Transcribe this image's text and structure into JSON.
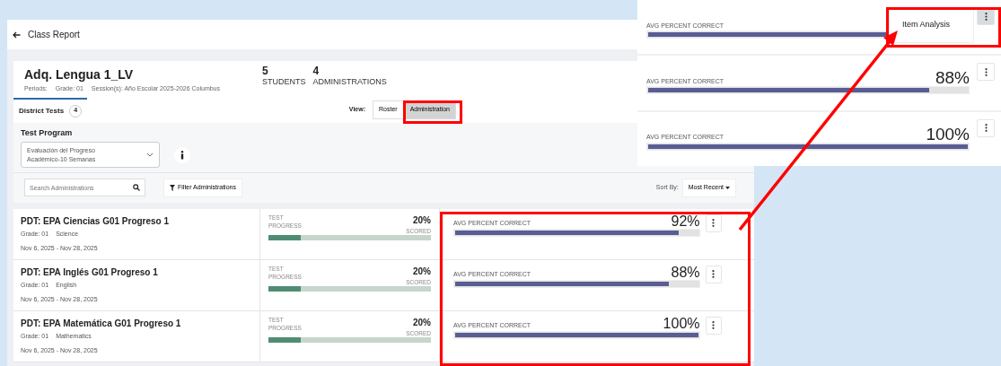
{
  "page": {
    "back_label": "Class Report"
  },
  "header": {
    "title": "Adq. Lengua 1_LV",
    "periods": "Periods:",
    "grade": "Grade: 01",
    "session": "Session(s): Año Escolar 2025-2026 Columbus",
    "stats": [
      {
        "value": "5",
        "label": "STUDENTS"
      },
      {
        "value": "4",
        "label": "ADMINISTRATIONS"
      }
    ]
  },
  "tabs": [
    {
      "label": "District Tests",
      "count": "4",
      "selected": true
    }
  ],
  "view": {
    "label": "View:",
    "options": [
      {
        "label": "Roster",
        "selected": false
      },
      {
        "label": "Administration",
        "selected": true
      }
    ]
  },
  "test_program": {
    "label": "Test Program",
    "value": "Evaluación del Progreso Académico-10 Semanas"
  },
  "search": {
    "placeholder": "Search Administrations"
  },
  "filter_button": "Filter Administrations",
  "sort": {
    "label": "Sort By:",
    "value": "Most Recent"
  },
  "administrations": [
    {
      "title": "PDT: EPA Ciencias G01 Progreso 1",
      "grade": "Grade: 01",
      "subject": "Science",
      "dates": "Nov 6, 2025 - Nov 28, 2025",
      "progress": {
        "label": "TEST PROGRESS",
        "value": "20%",
        "caption": "SCORED",
        "level": 0.2
      },
      "avg": {
        "label": "AVG PERCENT CORRECT",
        "value": "92%",
        "level": 0.92
      }
    },
    {
      "title": "PDT: EPA Inglés G01 Progreso 1",
      "grade": "Grade: 01",
      "subject": "English",
      "dates": "Nov 6, 2025 - Nov 28, 2025",
      "progress": {
        "label": "TEST PROGRESS",
        "value": "20%",
        "caption": "SCORED",
        "level": 0.2
      },
      "avg": {
        "label": "AVG PERCENT CORRECT",
        "value": "88%",
        "level": 0.88
      }
    },
    {
      "title": "PDT: EPA Matemática G01 Progreso 1",
      "grade": "Grade: 01",
      "subject": "Mathematics",
      "dates": "Nov 6, 2025 - Nov 28, 2025",
      "progress": {
        "label": "TEST PROGRESS",
        "value": "20%",
        "caption": "SCORED",
        "level": 0.2
      },
      "avg": {
        "label": "AVG PERCENT CORRECT",
        "value": "100%",
        "level": 1.0
      }
    }
  ],
  "inset": {
    "rows": [
      {
        "label": "AVG PERCENT CORRECT",
        "level": 0.92,
        "menu_open": true
      },
      {
        "label": "AVG PERCENT CORRECT",
        "value": "88%",
        "level": 0.88,
        "menu_open": false
      },
      {
        "label": "AVG PERCENT CORRECT",
        "value": "100%",
        "level": 1.0,
        "menu_open": false
      }
    ],
    "menu_items": [
      "Item Analysis"
    ]
  }
}
